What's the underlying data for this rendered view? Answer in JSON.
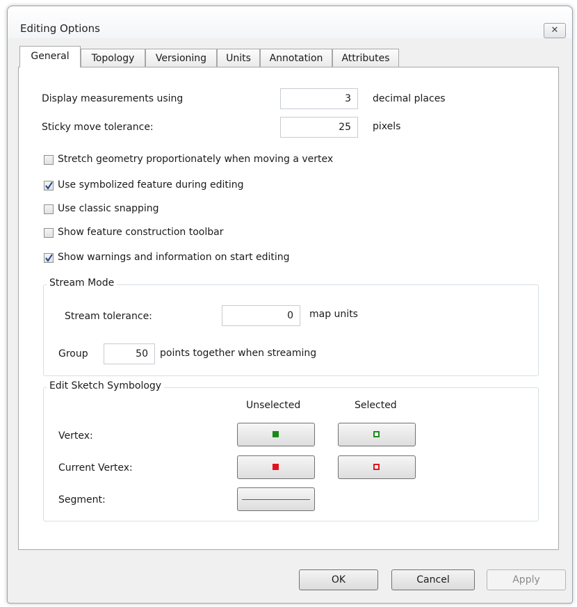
{
  "window": {
    "title": "Editing Options",
    "close_glyph": "✕"
  },
  "tabs": [
    {
      "label": "General",
      "active": true
    },
    {
      "label": "Topology"
    },
    {
      "label": "Versioning"
    },
    {
      "label": "Units"
    },
    {
      "label": "Annotation"
    },
    {
      "label": "Attributes"
    }
  ],
  "general": {
    "display_measurements": {
      "label": "Display measurements using",
      "value": "3",
      "suffix": "decimal places"
    },
    "sticky_move": {
      "label": "Sticky move tolerance:",
      "value": "25",
      "suffix": "pixels"
    },
    "checkboxes": [
      {
        "label": "Stretch geometry proportionately when moving a vertex",
        "checked": false
      },
      {
        "label": "Use symbolized feature during editing",
        "checked": true
      },
      {
        "label": "Use classic snapping",
        "checked": false
      },
      {
        "label": "Show feature construction toolbar",
        "checked": false
      },
      {
        "label": "Show warnings and information on start editing",
        "checked": true
      }
    ]
  },
  "stream_mode": {
    "title": "Stream Mode",
    "tolerance_label": "Stream tolerance:",
    "tolerance_value": "0",
    "tolerance_suffix": "map units",
    "group_label": "Group",
    "group_value": "50",
    "group_suffix": "points together when streaming"
  },
  "sketch": {
    "title": "Edit Sketch Symbology",
    "col_unselected": "Unselected",
    "col_selected": "Selected",
    "rows": {
      "vertex": "Vertex:",
      "current_vertex": "Current Vertex:",
      "segment": "Segment:"
    },
    "colors": {
      "vertex": "#1a8a1a",
      "current_vertex": "#e0141e",
      "segment": "#1a8a1a"
    }
  },
  "buttons": {
    "ok": "OK",
    "cancel": "Cancel",
    "apply": "Apply"
  }
}
